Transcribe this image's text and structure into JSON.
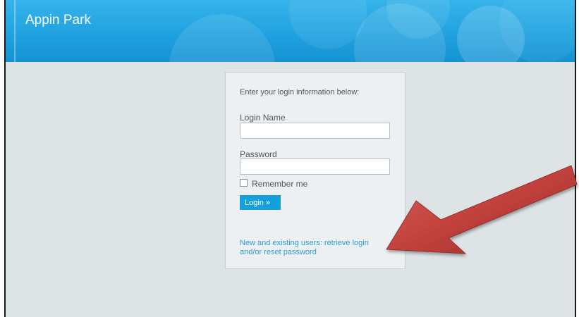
{
  "header": {
    "site_title": "Appin Park"
  },
  "login": {
    "intro_text": "Enter your login information below:",
    "login_name_label": "Login Name",
    "login_name_value": "",
    "password_label": "Password",
    "password_value": "",
    "remember_label": "Remember me",
    "remember_checked": false,
    "login_button_label": "Login »",
    "retrieve_link_text": "New and existing users: retrieve login and/or reset password"
  },
  "colors": {
    "header_blue": "#20a2e0",
    "button_blue": "#13a0dc",
    "link_blue": "#2d9bd0",
    "annotation_arrow": "#c0403c"
  },
  "icons": {
    "annotation": "arrow-pointer-icon"
  }
}
